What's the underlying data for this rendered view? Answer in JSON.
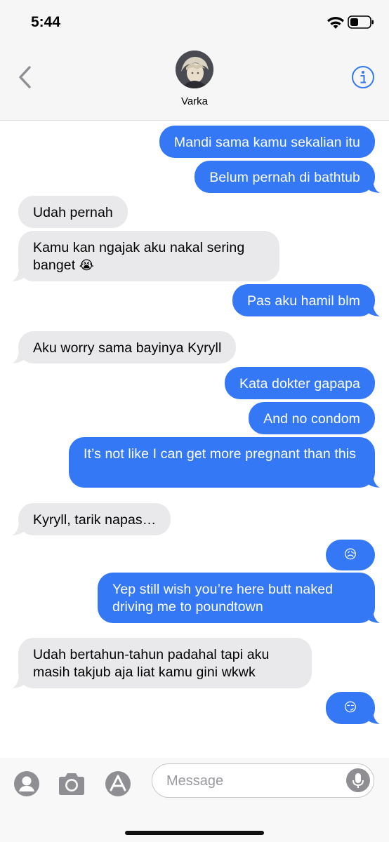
{
  "status": {
    "time": "5:44"
  },
  "header": {
    "contact_name": "Varka"
  },
  "messages": [
    {
      "from": "me",
      "text": "Mandi sama kamu sekalian itu"
    },
    {
      "from": "me",
      "text": "Belum pernah di bathtub"
    },
    {
      "from": "them",
      "text": "Udah pernah"
    },
    {
      "from": "them",
      "text": "Kamu kan ngajak aku nakal sering banget",
      "emoji": "😭"
    },
    {
      "from": "me",
      "text": "Pas aku hamil blm"
    },
    {
      "from": "them",
      "text": "Aku worry sama bayinya Kyryll"
    },
    {
      "from": "me",
      "text": "Kata dokter gapapa"
    },
    {
      "from": "me",
      "text": "And no condom"
    },
    {
      "from": "me",
      "text": "It’s not like I can get more pregnant than this"
    },
    {
      "from": "them",
      "text": "Kyryll, tarik napas…"
    },
    {
      "from": "me",
      "emoji": "😥"
    },
    {
      "from": "me",
      "text": "Yep still wish you’re here butt naked driving me to poundtown"
    },
    {
      "from": "them",
      "text": "Udah bertahun-tahun padahal tapi aku masih takjub aja liat kamu gini wkwk"
    },
    {
      "from": "me",
      "emoji": "😏"
    }
  ],
  "composer": {
    "placeholder": "Message"
  },
  "icons": {
    "back": "chevron-left-icon",
    "info": "info-icon",
    "memoji": "memoji-icon",
    "camera": "camera-icon",
    "appstore": "app-store-icon",
    "mic": "microphone-icon"
  },
  "colors": {
    "outgoing": "#3478f6",
    "incoming": "#e9e9eb",
    "accent": "#3478f6"
  }
}
